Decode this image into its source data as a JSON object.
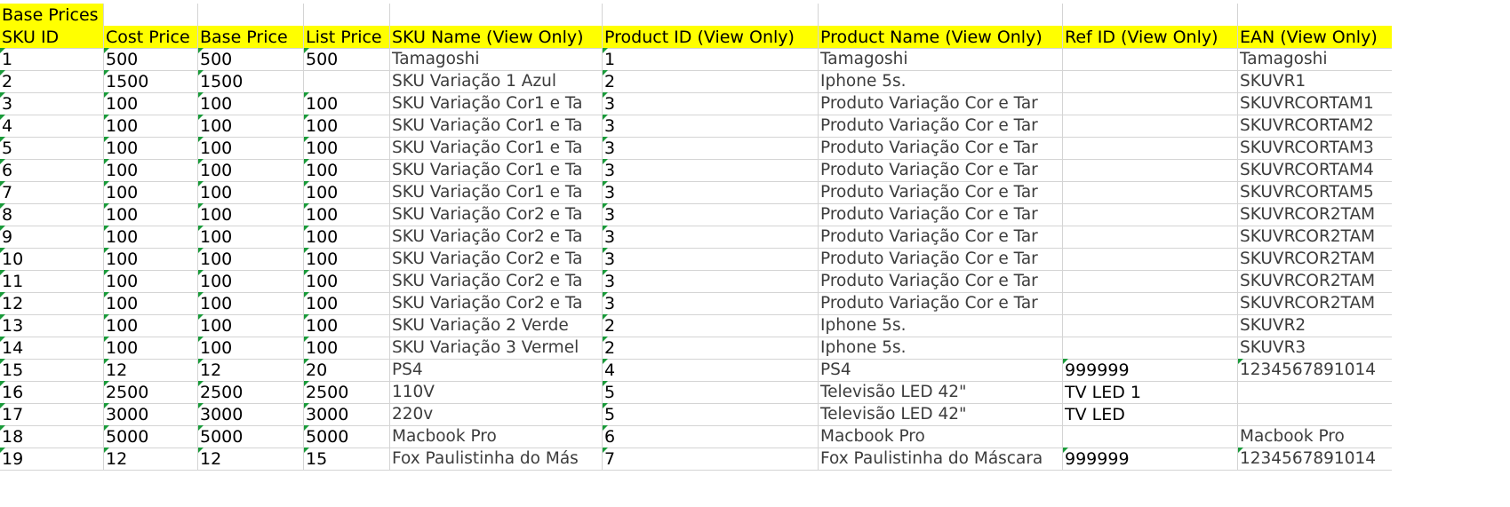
{
  "title_label": "Base Prices",
  "headers": [
    "SKU ID",
    "Cost Price",
    "Base Price",
    "List Price",
    "SKU Name (View Only)",
    "Product ID (View Only)",
    "Product Name (View Only)",
    "Ref ID (View Only)",
    "EAN (View Only)"
  ],
  "rows": [
    [
      "1",
      "500",
      "500",
      "500",
      "Tamagoshi",
      "1",
      "Tamagoshi",
      "",
      "Tamagoshi"
    ],
    [
      "2",
      "1500",
      "1500",
      "",
      "SKU Variação 1 Azul",
      "2",
      "Iphone 5s.",
      "",
      "SKUVR1"
    ],
    [
      "3",
      "100",
      "100",
      "100",
      "SKU Variação Cor1 e Ta",
      "3",
      "Produto Variação Cor e Tar",
      "",
      "SKUVRCORTAM1"
    ],
    [
      "4",
      "100",
      "100",
      "100",
      "SKU Variação Cor1 e Ta",
      "3",
      "Produto Variação Cor e Tar",
      "",
      "SKUVRCORTAM2"
    ],
    [
      "5",
      "100",
      "100",
      "100",
      "SKU Variação Cor1 e Ta",
      "3",
      "Produto Variação Cor e Tar",
      "",
      "SKUVRCORTAM3"
    ],
    [
      "6",
      "100",
      "100",
      "100",
      "SKU Variação Cor1 e Ta",
      "3",
      "Produto Variação Cor e Tar",
      "",
      "SKUVRCORTAM4"
    ],
    [
      "7",
      "100",
      "100",
      "100",
      "SKU Variação Cor1 e Ta",
      "3",
      "Produto Variação Cor e Tar",
      "",
      "SKUVRCORTAM5"
    ],
    [
      "8",
      "100",
      "100",
      "100",
      "SKU Variação Cor2 e Ta",
      "3",
      "Produto Variação Cor e Tar",
      "",
      "SKUVRCOR2TAM"
    ],
    [
      "9",
      "100",
      "100",
      "100",
      "SKU Variação Cor2 e Ta",
      "3",
      "Produto Variação Cor e Tar",
      "",
      "SKUVRCOR2TAM"
    ],
    [
      "10",
      "100",
      "100",
      "100",
      "SKU Variação Cor2 e Ta",
      "3",
      "Produto Variação Cor e Tar",
      "",
      "SKUVRCOR2TAM"
    ],
    [
      "11",
      "100",
      "100",
      "100",
      "SKU Variação Cor2 e Ta",
      "3",
      "Produto Variação Cor e Tar",
      "",
      "SKUVRCOR2TAM"
    ],
    [
      "12",
      "100",
      "100",
      "100",
      "SKU Variação Cor2 e Ta",
      "3",
      "Produto Variação Cor e Tar",
      "",
      "SKUVRCOR2TAM"
    ],
    [
      "13",
      "100",
      "100",
      "100",
      "SKU Variação 2 Verde",
      "2",
      "Iphone 5s.",
      "",
      "SKUVR2"
    ],
    [
      "14",
      "100",
      "100",
      "100",
      "SKU Variação 3 Vermel",
      "2",
      "Iphone 5s.",
      "",
      "SKUVR3"
    ],
    [
      "15",
      "12",
      "12",
      "20",
      "PS4",
      "4",
      "PS4",
      "999999",
      "1234567891014"
    ],
    [
      "16",
      "2500",
      "2500",
      "2500",
      "110V",
      "5",
      "Televisão LED 42\"",
      "TV LED 1",
      ""
    ],
    [
      "17",
      "3000",
      "3000",
      "3000",
      "220v",
      "5",
      "Televisão LED 42\"",
      "TV LED",
      ""
    ],
    [
      "18",
      "5000",
      "5000",
      "5000",
      "Macbook Pro",
      "6",
      "Macbook Pro",
      "",
      "Macbook Pro"
    ],
    [
      "19",
      "12",
      "12",
      "15",
      "Fox Paulistinha do Más",
      "7",
      "Fox Paulistinha do Máscara",
      "999999",
      "1234567891014"
    ]
  ],
  "colors": {
    "header_fill": "#ffff00",
    "gridline": "#d4d4d4",
    "error_triangle": "#1a9a3a"
  }
}
